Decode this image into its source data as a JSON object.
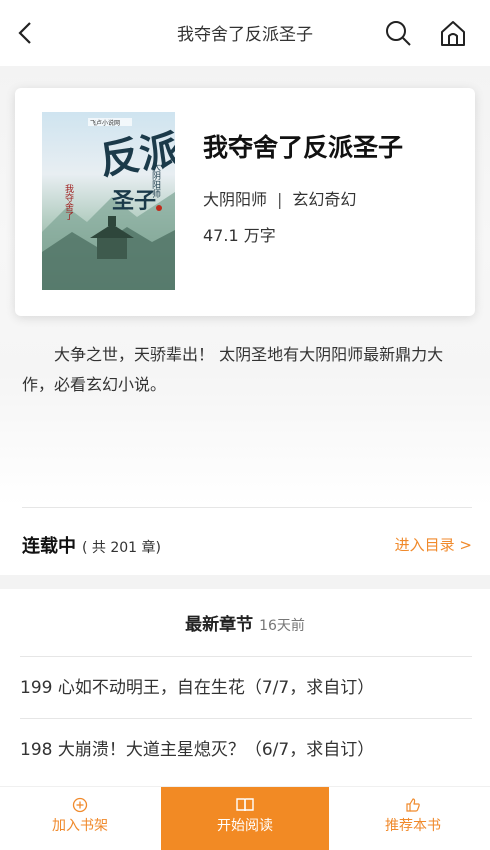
{
  "header": {
    "title": "我夺舍了反派圣子"
  },
  "book": {
    "title": "我夺舍了反派圣子",
    "author": "大阴阳师",
    "separator": "|",
    "category": "玄幻奇幻",
    "words": "47.1 万字",
    "cover": {
      "title_big": "反派",
      "title_small": "我夺舍了",
      "title_tail": "圣子",
      "author": "大阴阳师",
      "publisher": "飞卢小说网"
    }
  },
  "intro": "大争之世，天骄辈出！ 太阴圣地有大阴阳师最新鼎力大作，必看玄幻小说。",
  "status": {
    "label": "连载中",
    "count": "( 共 201 章)",
    "toc_link": "进入目录 >"
  },
  "latest": {
    "heading": "最新章节",
    "ago": "16天前",
    "chapters": [
      "199 心如不动明王，自在生花（7/7，求自订）",
      "198 大崩溃！大道主星熄灭？（6/7，求自订）"
    ]
  },
  "bottom_bar": {
    "add_shelf": "加入书架",
    "start_read": "开始阅读",
    "recommend": "推荐本书"
  },
  "colors": {
    "accent": "#f08a2c",
    "button_bg": "#f28a24"
  },
  "icons": {
    "back": "chevron-left-icon",
    "search": "search-icon",
    "home": "home-icon",
    "add": "plus-circle-icon",
    "book": "open-book-icon",
    "thumb": "thumbs-up-icon"
  }
}
